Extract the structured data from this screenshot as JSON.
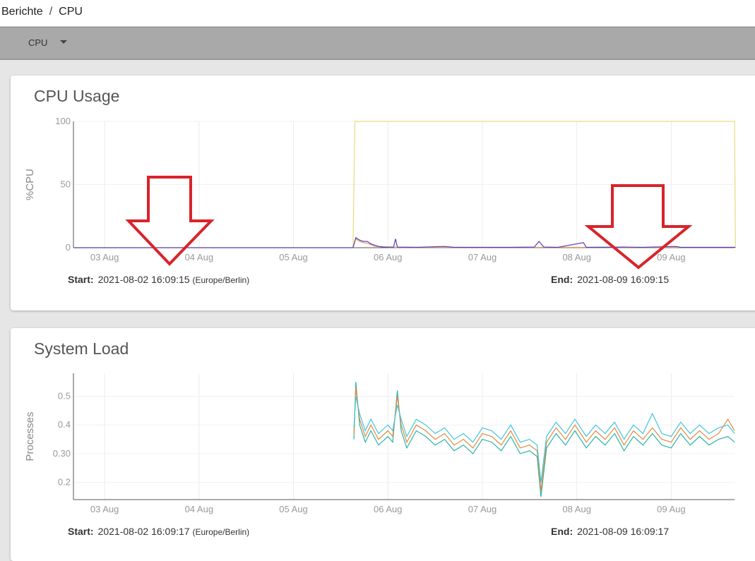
{
  "breadcrumb": {
    "root": "Berichte",
    "separator": "/",
    "current": "CPU"
  },
  "toolbar": {
    "selector_value": "CPU"
  },
  "cpu_card": {
    "title": "CPU Usage",
    "start_label": "Start:",
    "start_value": "2021-08-02 16:09:15",
    "start_tz": "(Europe/Berlin)",
    "end_label": "End:",
    "end_value": "2021-08-09 16:09:15"
  },
  "load_card": {
    "title": "System Load",
    "start_label": "Start:",
    "start_value": "2021-08-02 16:09:17",
    "start_tz": "(Europe/Berlin)",
    "end_label": "End:",
    "end_value": "2021-08-09 16:09:17"
  },
  "chart_data": [
    {
      "type": "line",
      "title": "CPU Usage",
      "ylabel": "%CPU",
      "xlabel": "",
      "ylim": [
        0,
        100
      ],
      "yticks": [
        "0",
        "50",
        "100"
      ],
      "xticks": [
        "03 Aug",
        "04 Aug",
        "05 Aug",
        "06 Aug",
        "07 Aug",
        "08 Aug",
        "09 Aug"
      ],
      "x_range_days": [
        2.67,
        9.67
      ],
      "grid": true,
      "series": [
        {
          "color": "#e4dc7a",
          "points": [
            [
              2.67,
              0
            ],
            [
              5.63,
              0
            ],
            [
              5.65,
              100
            ],
            [
              9.67,
              100
            ],
            [
              9.68,
              0
            ]
          ]
        },
        {
          "color": "#e0a060",
          "points": [
            [
              5.63,
              0
            ],
            [
              5.66,
              7
            ],
            [
              5.7,
              5
            ],
            [
              5.74,
              4
            ],
            [
              5.8,
              3
            ],
            [
              5.86,
              1
            ],
            [
              6.0,
              0.5
            ],
            [
              6.1,
              0.3
            ],
            [
              9.68,
              0.3
            ]
          ]
        },
        {
          "color": "#5b3fb5",
          "points": [
            [
              2.67,
              0
            ],
            [
              5.63,
              0
            ],
            [
              5.66,
              8
            ],
            [
              5.7,
              6
            ],
            [
              5.74,
              5
            ],
            [
              5.78,
              5
            ],
            [
              5.82,
              3
            ],
            [
              5.86,
              2
            ],
            [
              5.9,
              1
            ],
            [
              5.95,
              0.5
            ],
            [
              6.0,
              0.5
            ],
            [
              6.06,
              0.5
            ],
            [
              6.08,
              7
            ],
            [
              6.1,
              0.5
            ],
            [
              6.3,
              0.3
            ],
            [
              6.6,
              1
            ],
            [
              6.7,
              0.3
            ],
            [
              7.3,
              0.3
            ],
            [
              7.55,
              0.5
            ],
            [
              7.6,
              5
            ],
            [
              7.65,
              0.5
            ],
            [
              7.8,
              0.3
            ],
            [
              8.07,
              4
            ],
            [
              8.1,
              0.3
            ],
            [
              8.5,
              0.5
            ],
            [
              8.7,
              0.3
            ],
            [
              9.05,
              1
            ],
            [
              9.1,
              0.3
            ],
            [
              9.68,
              0.3
            ]
          ]
        }
      ]
    },
    {
      "type": "line",
      "title": "System Load",
      "ylabel": "Processes",
      "xlabel": "",
      "ylim": [
        0.14,
        0.58
      ],
      "yticks": [
        "0.2",
        "0.30",
        "0.4",
        "0.5"
      ],
      "xticks": [
        "03 Aug",
        "04 Aug",
        "05 Aug",
        "06 Aug",
        "07 Aug",
        "08 Aug",
        "09 Aug"
      ],
      "x_range_days": [
        2.67,
        9.67
      ],
      "grid": true,
      "series_colors": [
        "#2ab3a8",
        "#e08a3c",
        "#3ec6e0"
      ],
      "series": [
        {
          "color": "#2ab3a8",
          "points": [
            [
              5.64,
              0.35
            ],
            [
              5.66,
              0.55
            ],
            [
              5.7,
              0.4
            ],
            [
              5.76,
              0.34
            ],
            [
              5.82,
              0.38
            ],
            [
              5.9,
              0.33
            ],
            [
              6.0,
              0.36
            ],
            [
              6.05,
              0.34
            ],
            [
              6.1,
              0.52
            ],
            [
              6.14,
              0.38
            ],
            [
              6.2,
              0.32
            ],
            [
              6.3,
              0.38
            ],
            [
              6.4,
              0.36
            ],
            [
              6.5,
              0.33
            ],
            [
              6.6,
              0.35
            ],
            [
              6.7,
              0.31
            ],
            [
              6.8,
              0.33
            ],
            [
              6.9,
              0.3
            ],
            [
              7.0,
              0.35
            ],
            [
              7.1,
              0.34
            ],
            [
              7.2,
              0.31
            ],
            [
              7.3,
              0.36
            ],
            [
              7.4,
              0.3
            ],
            [
              7.5,
              0.31
            ],
            [
              7.58,
              0.29
            ],
            [
              7.62,
              0.15
            ],
            [
              7.68,
              0.32
            ],
            [
              7.78,
              0.37
            ],
            [
              7.88,
              0.33
            ],
            [
              7.98,
              0.38
            ],
            [
              8.1,
              0.32
            ],
            [
              8.2,
              0.36
            ],
            [
              8.3,
              0.33
            ],
            [
              8.4,
              0.37
            ],
            [
              8.5,
              0.31
            ],
            [
              8.6,
              0.36
            ],
            [
              8.7,
              0.33
            ],
            [
              8.8,
              0.37
            ],
            [
              8.9,
              0.33
            ],
            [
              9.0,
              0.32
            ],
            [
              9.1,
              0.37
            ],
            [
              9.2,
              0.33
            ],
            [
              9.3,
              0.36
            ],
            [
              9.4,
              0.33
            ],
            [
              9.5,
              0.35
            ],
            [
              9.6,
              0.36
            ],
            [
              9.67,
              0.34
            ]
          ]
        },
        {
          "color": "#e08a3c",
          "points": [
            [
              5.64,
              0.37
            ],
            [
              5.66,
              0.53
            ],
            [
              5.7,
              0.42
            ],
            [
              5.76,
              0.36
            ],
            [
              5.82,
              0.4
            ],
            [
              5.9,
              0.35
            ],
            [
              6.0,
              0.38
            ],
            [
              6.05,
              0.36
            ],
            [
              6.1,
              0.5
            ],
            [
              6.14,
              0.4
            ],
            [
              6.2,
              0.34
            ],
            [
              6.3,
              0.4
            ],
            [
              6.4,
              0.38
            ],
            [
              6.5,
              0.35
            ],
            [
              6.6,
              0.37
            ],
            [
              6.7,
              0.33
            ],
            [
              6.8,
              0.35
            ],
            [
              6.9,
              0.32
            ],
            [
              7.0,
              0.37
            ],
            [
              7.1,
              0.36
            ],
            [
              7.2,
              0.33
            ],
            [
              7.3,
              0.38
            ],
            [
              7.4,
              0.32
            ],
            [
              7.5,
              0.33
            ],
            [
              7.58,
              0.31
            ],
            [
              7.62,
              0.17
            ],
            [
              7.68,
              0.34
            ],
            [
              7.78,
              0.39
            ],
            [
              7.88,
              0.35
            ],
            [
              7.98,
              0.4
            ],
            [
              8.1,
              0.34
            ],
            [
              8.2,
              0.38
            ],
            [
              8.3,
              0.35
            ],
            [
              8.4,
              0.39
            ],
            [
              8.5,
              0.33
            ],
            [
              8.6,
              0.38
            ],
            [
              8.7,
              0.35
            ],
            [
              8.8,
              0.39
            ],
            [
              8.9,
              0.35
            ],
            [
              9.0,
              0.34
            ],
            [
              9.1,
              0.39
            ],
            [
              9.2,
              0.35
            ],
            [
              9.3,
              0.38
            ],
            [
              9.4,
              0.35
            ],
            [
              9.5,
              0.37
            ],
            [
              9.6,
              0.42
            ],
            [
              9.67,
              0.38
            ]
          ]
        },
        {
          "color": "#3ec6e0",
          "points": [
            [
              5.64,
              0.39
            ],
            [
              5.66,
              0.5
            ],
            [
              5.7,
              0.44
            ],
            [
              5.76,
              0.38
            ],
            [
              5.82,
              0.42
            ],
            [
              5.9,
              0.37
            ],
            [
              6.0,
              0.4
            ],
            [
              6.05,
              0.38
            ],
            [
              6.1,
              0.47
            ],
            [
              6.14,
              0.42
            ],
            [
              6.2,
              0.36
            ],
            [
              6.3,
              0.42
            ],
            [
              6.4,
              0.4
            ],
            [
              6.5,
              0.37
            ],
            [
              6.6,
              0.39
            ],
            [
              6.7,
              0.35
            ],
            [
              6.8,
              0.37
            ],
            [
              6.9,
              0.34
            ],
            [
              7.0,
              0.39
            ],
            [
              7.1,
              0.38
            ],
            [
              7.2,
              0.35
            ],
            [
              7.3,
              0.4
            ],
            [
              7.4,
              0.34
            ],
            [
              7.5,
              0.35
            ],
            [
              7.58,
              0.33
            ],
            [
              7.62,
              0.2
            ],
            [
              7.68,
              0.36
            ],
            [
              7.78,
              0.41
            ],
            [
              7.88,
              0.37
            ],
            [
              7.98,
              0.42
            ],
            [
              8.1,
              0.36
            ],
            [
              8.2,
              0.4
            ],
            [
              8.3,
              0.37
            ],
            [
              8.4,
              0.41
            ],
            [
              8.5,
              0.35
            ],
            [
              8.6,
              0.4
            ],
            [
              8.7,
              0.37
            ],
            [
              8.8,
              0.44
            ],
            [
              8.9,
              0.37
            ],
            [
              9.0,
              0.36
            ],
            [
              9.1,
              0.41
            ],
            [
              9.2,
              0.37
            ],
            [
              9.3,
              0.4
            ],
            [
              9.4,
              0.37
            ],
            [
              9.5,
              0.39
            ],
            [
              9.6,
              0.4
            ],
            [
              9.67,
              0.37
            ]
          ]
        }
      ]
    }
  ],
  "annotations": {
    "arrow_color": "#d9232a"
  }
}
